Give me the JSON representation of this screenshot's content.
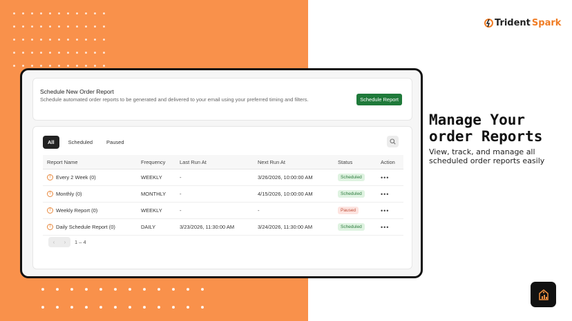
{
  "brand": {
    "name_part1": "Trident",
    "name_part2": "Spark",
    "accent": "#f07c24"
  },
  "colors": {
    "orange_bg": "#f9914b",
    "button_green": "#1f7a3a"
  },
  "schedule_card": {
    "title": "Schedule New Order Report",
    "description": "Schedule automated order reports to be generated and delivered to your email using your preferred timing and filters.",
    "button_label": "Schedule Report"
  },
  "tabs": [
    {
      "label": "All",
      "active": true
    },
    {
      "label": "Scheduled",
      "active": false
    },
    {
      "label": "Paused",
      "active": false
    }
  ],
  "search_icon": "search-icon",
  "table": {
    "headers": [
      "Report Name",
      "Frequency",
      "Last Run At",
      "Next Run At",
      "Status",
      "Action"
    ],
    "rows": [
      {
        "name": "Every 2 Week (0)",
        "frequency": "WEEKLY",
        "last_run": "-",
        "next_run": "3/26/2026, 10:00:00 AM",
        "status": "Scheduled",
        "action": "•••"
      },
      {
        "name": "Monthly (0)",
        "frequency": "MONTHLY",
        "last_run": "-",
        "next_run": "4/15/2026, 10:00:00 AM",
        "status": "Scheduled",
        "action": "•••"
      },
      {
        "name": "Weekly Report (0)",
        "frequency": "WEEKLY",
        "last_run": "-",
        "next_run": "-",
        "status": "Paused",
        "action": "•••"
      },
      {
        "name": "Daily Schedule Report (0)",
        "frequency": "DAILY",
        "last_run": "3/23/2026, 11:30:00 AM",
        "next_run": "3/24/2026, 11:30:00 AM",
        "status": "Scheduled",
        "action": "•••"
      }
    ]
  },
  "pagination": {
    "prev": "‹",
    "next": "›",
    "range": "1 – 4"
  },
  "promo": {
    "headline_line1": "Manage Your",
    "headline_line2": "order Reports",
    "subline": "View, track, and manage all scheduled order reports easily"
  }
}
